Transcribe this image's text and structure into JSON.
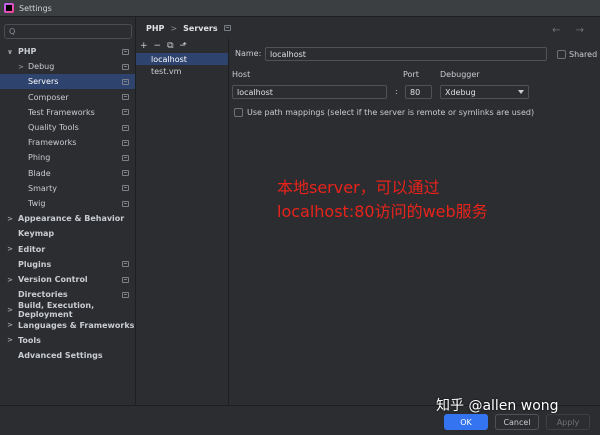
{
  "window": {
    "title": "Settings"
  },
  "search": {
    "placeholder": "Q"
  },
  "sidebar": {
    "items": [
      {
        "label": "PHP",
        "arrow": "∨",
        "level": 0,
        "bold": true,
        "badge": true
      },
      {
        "label": "Debug",
        "arrow": ">",
        "level": 1,
        "bold": false,
        "badge": true
      },
      {
        "label": "Servers",
        "arrow": "",
        "level": 1,
        "bold": false,
        "badge": true,
        "selected": true
      },
      {
        "label": "Composer",
        "arrow": "",
        "level": 1,
        "bold": false,
        "badge": true
      },
      {
        "label": "Test Frameworks",
        "arrow": "",
        "level": 1,
        "bold": false,
        "badge": true
      },
      {
        "label": "Quality Tools",
        "arrow": "",
        "level": 1,
        "bold": false,
        "badge": true
      },
      {
        "label": "Frameworks",
        "arrow": "",
        "level": 1,
        "bold": false,
        "badge": true
      },
      {
        "label": "Phing",
        "arrow": "",
        "level": 1,
        "bold": false,
        "badge": true
      },
      {
        "label": "Blade",
        "arrow": "",
        "level": 1,
        "bold": false,
        "badge": true
      },
      {
        "label": "Smarty",
        "arrow": "",
        "level": 1,
        "bold": false,
        "badge": true
      },
      {
        "label": "Twig",
        "arrow": "",
        "level": 1,
        "bold": false,
        "badge": true
      },
      {
        "label": "Appearance & Behavior",
        "arrow": ">",
        "level": 0,
        "bold": true,
        "badge": false
      },
      {
        "label": "Keymap",
        "arrow": "",
        "level": 0,
        "bold": true,
        "badge": false
      },
      {
        "label": "Editor",
        "arrow": ">",
        "level": 0,
        "bold": true,
        "badge": false
      },
      {
        "label": "Plugins",
        "arrow": "",
        "level": 0,
        "bold": true,
        "badge": true
      },
      {
        "label": "Version Control",
        "arrow": ">",
        "level": 0,
        "bold": true,
        "badge": true
      },
      {
        "label": "Directories",
        "arrow": "",
        "level": 0,
        "bold": true,
        "badge": true
      },
      {
        "label": "Build, Execution, Deployment",
        "arrow": ">",
        "level": 0,
        "bold": true,
        "badge": false
      },
      {
        "label": "Languages & Frameworks",
        "arrow": ">",
        "level": 0,
        "bold": true,
        "badge": false
      },
      {
        "label": "Tools",
        "arrow": ">",
        "level": 0,
        "bold": true,
        "badge": false
      },
      {
        "label": "Advanced Settings",
        "arrow": "",
        "level": 0,
        "bold": true,
        "badge": false
      }
    ]
  },
  "breadcrumb": {
    "parent": "PHP",
    "separator": ">",
    "current": "Servers"
  },
  "nav_arrows": "← →",
  "toolbar": {
    "add": "+",
    "remove": "−",
    "copy": "⧉",
    "edit": "⬏"
  },
  "servers": [
    {
      "name": "localhost",
      "selected": true
    },
    {
      "name": "test.vm",
      "selected": false
    }
  ],
  "form": {
    "name_label": "Name:",
    "name_value": "localhost",
    "shared_label": "Shared",
    "host_label": "Host",
    "host_value": "localhost",
    "port_label": "Port",
    "port_sep": ":",
    "port_value": "80",
    "debugger_label": "Debugger",
    "debugger_value": "Xdebug",
    "path_mapping_label": "Use path mappings (select if the server is remote or symlinks are used)"
  },
  "annotation": {
    "line1": "本地server，可以通过",
    "line2": "localhost:80访问的web服务"
  },
  "buttons": {
    "ok": "OK",
    "cancel": "Cancel",
    "apply": "Apply",
    "help": "?"
  },
  "watermark": "知乎 @allen wong",
  "colors": {
    "accent": "#3574f0",
    "selection": "#2e436e",
    "annotation": "#e8231b"
  }
}
